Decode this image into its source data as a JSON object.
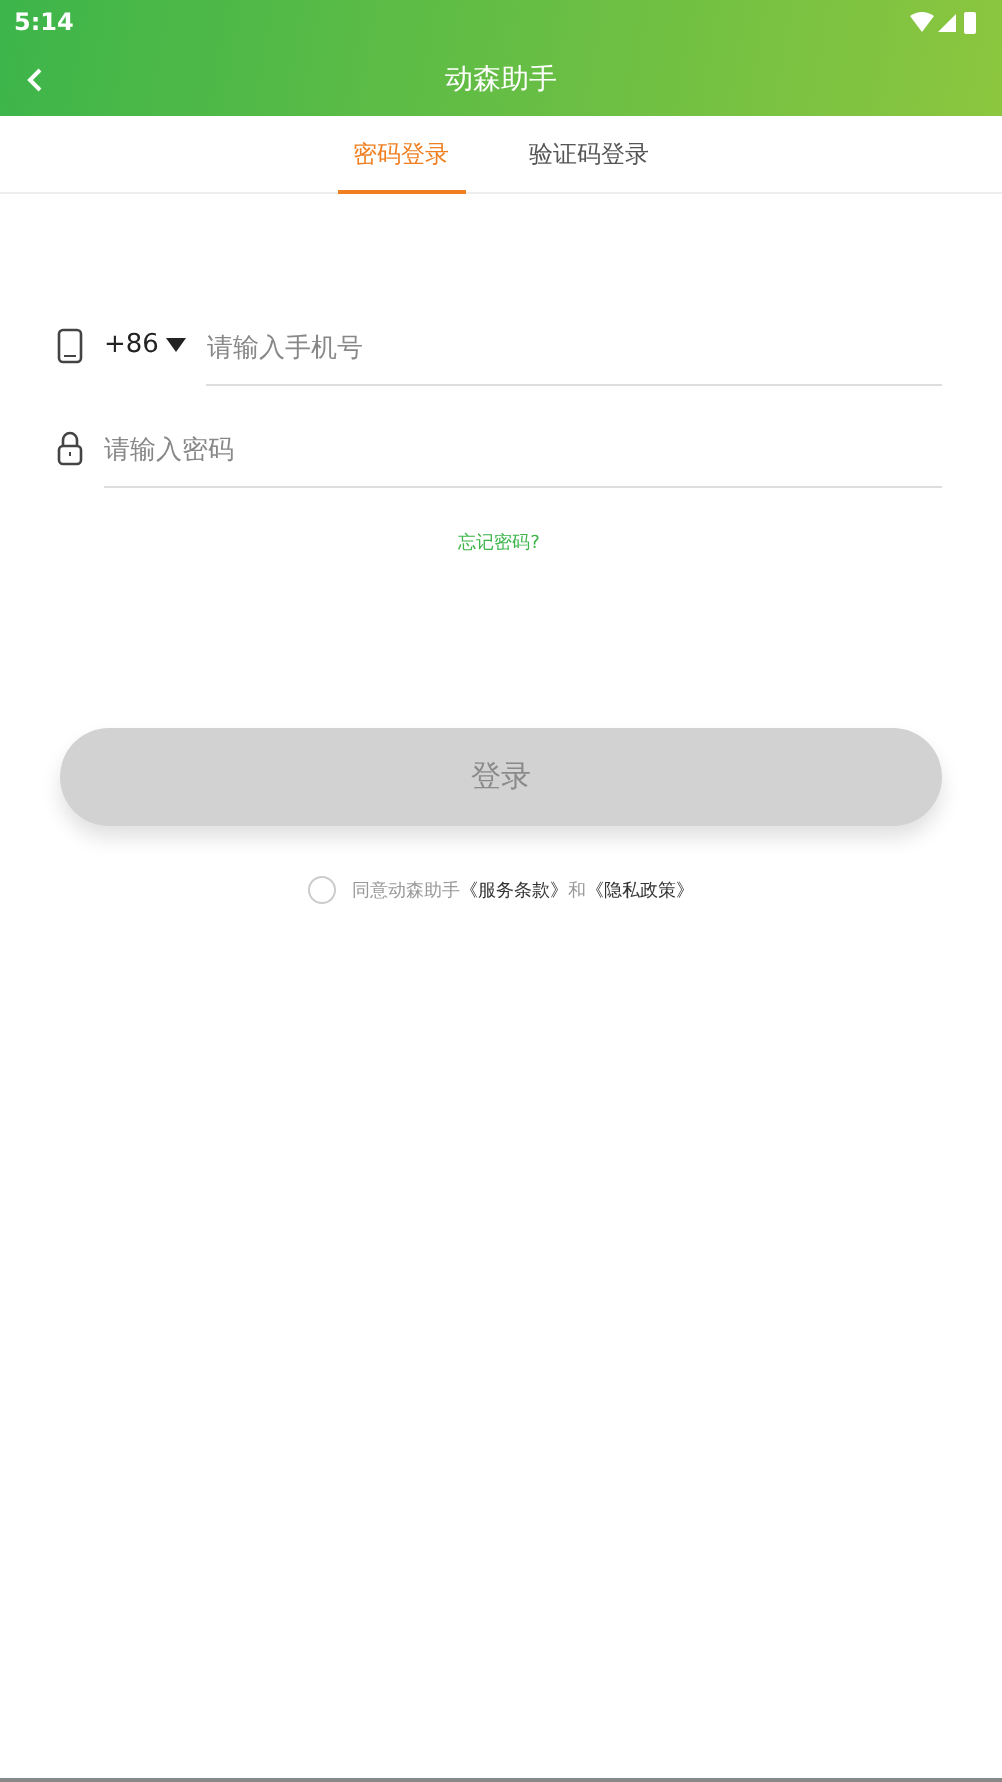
{
  "status_bar": {
    "time": "5:14"
  },
  "toolbar": {
    "title": "动森助手"
  },
  "tabs": [
    {
      "label": "密码登录",
      "selected": true
    },
    {
      "label": "验证码登录",
      "selected": false
    }
  ],
  "phone_field": {
    "country_code": "+86",
    "placeholder": "请输入手机号"
  },
  "password_field": {
    "placeholder": "请输入密码"
  },
  "forgot_link": "忘记密码?",
  "login_button": {
    "label": "登录",
    "disabled": true
  },
  "agreement": {
    "checked": false,
    "prefix": "同意动森助手",
    "terms_link": "《服务条款》",
    "joiner": "和",
    "privacy_link": "《隐私政策》"
  }
}
